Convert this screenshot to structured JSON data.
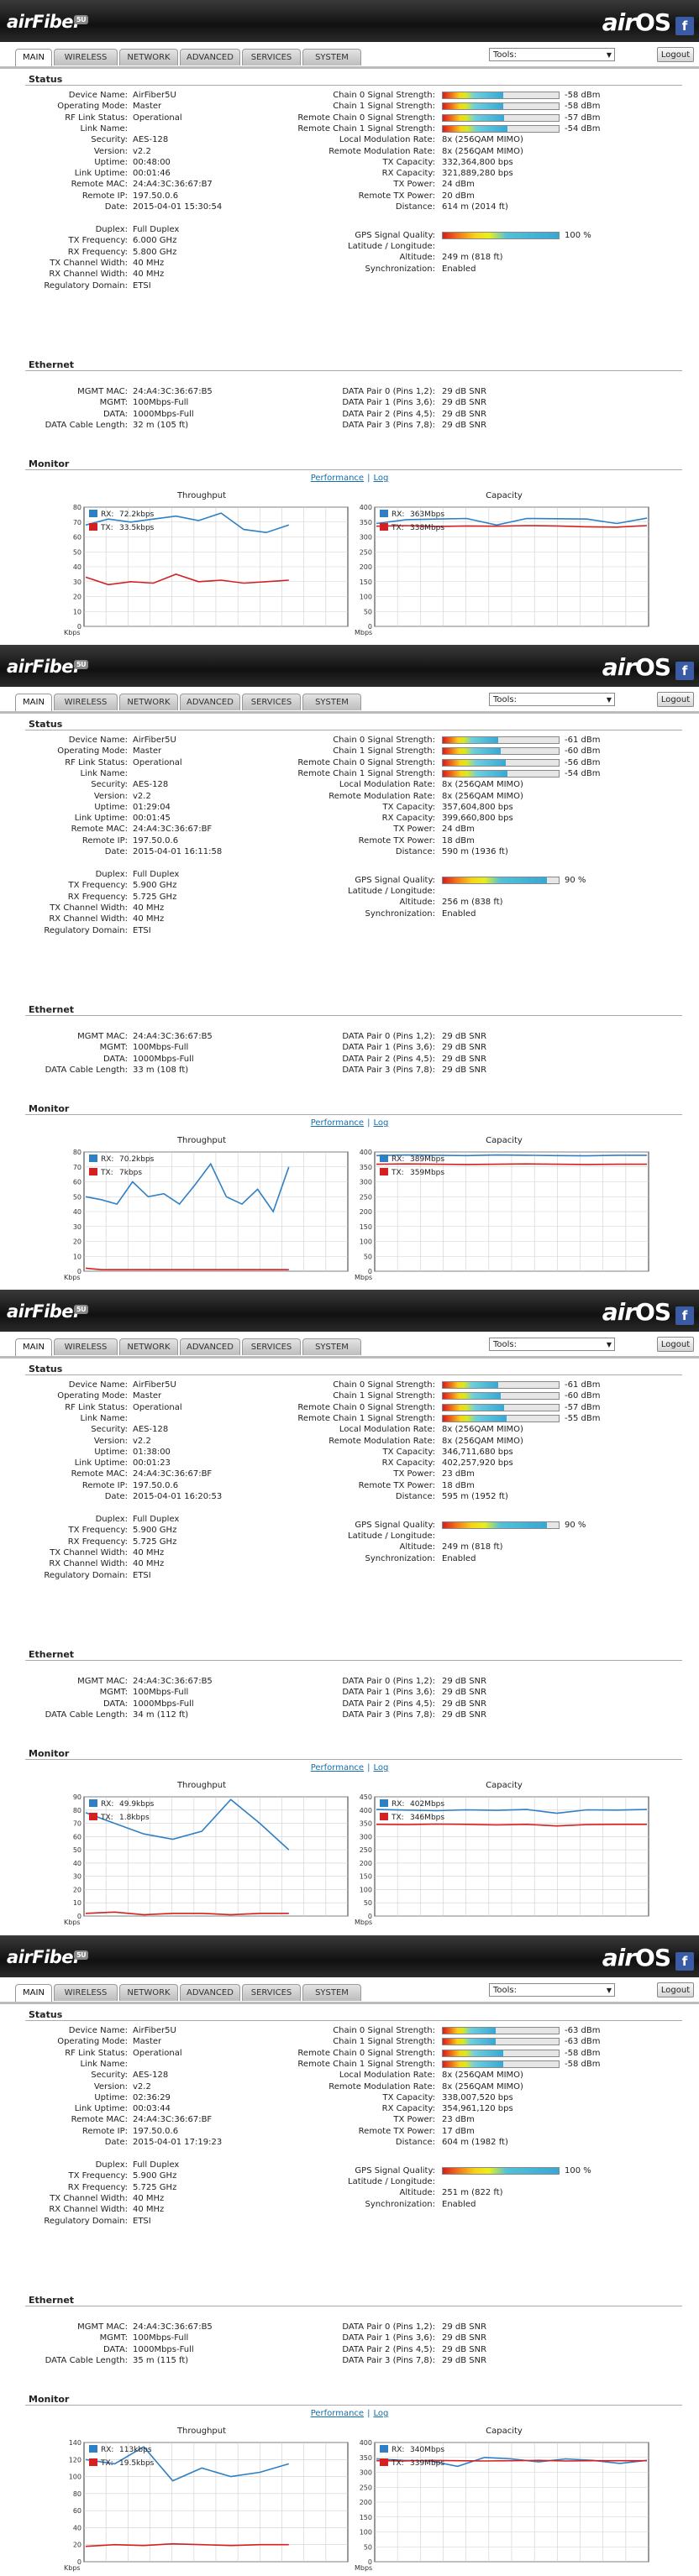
{
  "header": {
    "brand_left": "airFiber",
    "brand_left_badge": "5U",
    "brand_right_prefix": "air",
    "brand_right_suffix": "OS",
    "fb_icon": "f"
  },
  "tabs": [
    "MAIN",
    "WIRELESS",
    "NETWORK",
    "ADVANCED",
    "SERVICES",
    "SYSTEM"
  ],
  "tools_label": "Tools:",
  "logout_label": "Logout",
  "sections": {
    "status": "Status",
    "ethernet": "Ethernet",
    "monitor": "Monitor"
  },
  "labels": {
    "device_name": "Device Name:",
    "operating_mode": "Operating Mode:",
    "rf_link_status": "RF Link Status:",
    "link_name": "Link Name:",
    "security": "Security:",
    "version": "Version:",
    "uptime": "Uptime:",
    "link_uptime": "Link Uptime:",
    "remote_mac": "Remote MAC:",
    "remote_ip": "Remote IP:",
    "date": "Date:",
    "duplex": "Duplex:",
    "tx_frequency": "TX Frequency:",
    "rx_frequency": "RX Frequency:",
    "tx_channel_width": "TX Channel Width:",
    "rx_channel_width": "RX Channel Width:",
    "regulatory_domain": "Regulatory Domain:",
    "chain0": "Chain 0 Signal Strength:",
    "chain1": "Chain 1 Signal Strength:",
    "rchain0": "Remote Chain 0 Signal Strength:",
    "rchain1": "Remote Chain 1 Signal Strength:",
    "local_mod": "Local Modulation Rate:",
    "remote_mod": "Remote Modulation Rate:",
    "tx_capacity": "TX Capacity:",
    "rx_capacity": "RX Capacity:",
    "tx_power": "TX Power:",
    "remote_tx_power": "Remote TX Power:",
    "distance": "Distance:",
    "gps": "GPS Signal Quality:",
    "latlon": "Latitude / Longitude:",
    "altitude": "Altitude:",
    "sync": "Synchronization:",
    "mgmt_mac": "MGMT MAC:",
    "mgmt": "MGMT:",
    "data": "DATA:",
    "cable": "DATA Cable Length:",
    "dp0": "DATA Pair 0 (Pins 1,2):",
    "dp1": "DATA Pair 1 (Pins 3,6):",
    "dp2": "DATA Pair 2 (Pins 4,5):",
    "dp3": "DATA Pair 3 (Pins 7,8):"
  },
  "monitor_links": {
    "performance": "Performance",
    "sep": "|",
    "log": "Log"
  },
  "chart_titles": {
    "throughput": "Throughput",
    "capacity": "Capacity",
    "kbps": "Kbps",
    "mbps": "Mbps",
    "rx_prefix": "RX:",
    "tx_prefix": "TX:"
  },
  "colors": {
    "rx": "#2f7fc4",
    "tx": "#d42020",
    "grid": "#cfcfcf"
  },
  "panels": [
    {
      "status": {
        "device_name": "AirFiber5U",
        "operating_mode": "Master",
        "rf_link_status": "Operational",
        "link_name": "",
        "security": "AES-128",
        "version": "v2.2",
        "uptime": "00:48:00",
        "link_uptime": "00:01:46",
        "remote_mac": "24:A4:3C:36:67:B7",
        "remote_ip": "197.50.0.6",
        "date": "2015-04-01 15:30:54",
        "duplex": "Full Duplex",
        "tx_frequency": "6.000 GHz",
        "rx_frequency": "5.800 GHz",
        "tx_channel_width": "40 MHz",
        "rx_channel_width": "40 MHz",
        "regulatory_domain": "ETSI"
      },
      "signals": {
        "chain0": "-58 dBm",
        "chain1": "-58 dBm",
        "rchain0": "-57 dBm",
        "rchain1": "-54 dBm",
        "chain0_level": 0.52,
        "chain1_level": 0.52,
        "rchain0_level": 0.53,
        "rchain1_level": 0.56
      },
      "link": {
        "local_mod": "8x (256QAM MIMO)",
        "remote_mod": "8x (256QAM MIMO)",
        "tx_capacity": "332,364,800 bps",
        "rx_capacity": "321,889,280 bps",
        "tx_power": "24 dBm",
        "remote_tx_power": "20 dBm",
        "distance": "614 m (2014 ft)",
        "gps": "100 %",
        "gps_level": 1.0,
        "latlon": "",
        "altitude": "249 m (818 ft)",
        "sync": "Enabled"
      },
      "ethernet": {
        "mgmt_mac": "24:A4:3C:36:67:B5",
        "mgmt": "100Mbps-Full",
        "data": "1000Mbps-Full",
        "cable": "32 m (105 ft)",
        "dp0": "29 dB SNR",
        "dp1": "29 dB SNR",
        "dp2": "29 dB SNR",
        "dp3": "29 dB SNR"
      },
      "throughput": {
        "rx_label": "72.2kbps",
        "tx_label": "33.5kbps",
        "y_ticks": [
          "80",
          "70",
          "60",
          "50",
          "40",
          "30",
          "20",
          "10",
          "0"
        ],
        "ymax": 80,
        "rx": [
          68,
          72,
          70,
          72,
          74,
          71,
          76,
          65,
          63,
          68
        ],
        "tx": [
          33,
          28,
          30,
          29,
          35,
          30,
          31,
          29,
          30,
          31
        ]
      },
      "capacity": {
        "rx_label": "363Mbps",
        "tx_label": "338Mbps",
        "y_ticks": [
          "400",
          "350",
          "300",
          "250",
          "200",
          "150",
          "100",
          "50",
          "0"
        ],
        "ymax": 400,
        "rx": [
          345,
          358,
          360,
          362,
          340,
          362,
          361,
          360,
          345,
          363
        ],
        "tx": [
          336,
          338,
          335,
          337,
          336,
          338,
          337,
          334,
          333,
          338
        ]
      }
    },
    {
      "status": {
        "device_name": "AirFiber5U",
        "operating_mode": "Master",
        "rf_link_status": "Operational",
        "link_name": "",
        "security": "AES-128",
        "version": "v2.2",
        "uptime": "01:29:04",
        "link_uptime": "00:01:45",
        "remote_mac": "24:A4:3C:36:67:BF",
        "remote_ip": "197.50.0.6",
        "date": "2015-04-01 16:11:58",
        "duplex": "Full Duplex",
        "tx_frequency": "5.900 GHz",
        "rx_frequency": "5.725 GHz",
        "tx_channel_width": "40 MHz",
        "rx_channel_width": "40 MHz",
        "regulatory_domain": "ETSI"
      },
      "signals": {
        "chain0": "-61 dBm",
        "chain1": "-60 dBm",
        "rchain0": "-56 dBm",
        "rchain1": "-54 dBm",
        "chain0_level": 0.48,
        "chain1_level": 0.5,
        "rchain0_level": 0.54,
        "rchain1_level": 0.56
      },
      "link": {
        "local_mod": "8x (256QAM MIMO)",
        "remote_mod": "8x (256QAM MIMO)",
        "tx_capacity": "357,604,800 bps",
        "rx_capacity": "399,660,800 bps",
        "tx_power": "24 dBm",
        "remote_tx_power": "18 dBm",
        "distance": "590 m (1936 ft)",
        "gps": "90 %",
        "gps_level": 0.9,
        "latlon": "",
        "altitude": "256 m (838 ft)",
        "sync": "Enabled"
      },
      "ethernet": {
        "mgmt_mac": "24:A4:3C:36:67:B5",
        "mgmt": "100Mbps-Full",
        "data": "1000Mbps-Full",
        "cable": "33 m (108 ft)",
        "dp0": "29 dB SNR",
        "dp1": "29 dB SNR",
        "dp2": "29 dB SNR",
        "dp3": "29 dB SNR"
      },
      "throughput": {
        "rx_label": "70.2kbps",
        "tx_label": "7kbps",
        "y_ticks": [
          "80",
          "70",
          "60",
          "50",
          "40",
          "30",
          "20",
          "10",
          "0"
        ],
        "ymax": 80,
        "rx": [
          50,
          48,
          45,
          60,
          50,
          52,
          45,
          58,
          72,
          50,
          45,
          55,
          40,
          70
        ],
        "tx": [
          2,
          1,
          1,
          1,
          1,
          1,
          1,
          1,
          1,
          1,
          1,
          1,
          1,
          1
        ]
      },
      "capacity": {
        "rx_label": "389Mbps",
        "tx_label": "359Mbps",
        "y_ticks": [
          "400",
          "350",
          "300",
          "250",
          "200",
          "150",
          "100",
          "50",
          "0"
        ],
        "ymax": 400,
        "rx": [
          388,
          390,
          389,
          388,
          390,
          389,
          388,
          387,
          389,
          389
        ],
        "tx": [
          359,
          360,
          359,
          358,
          359,
          360,
          359,
          358,
          359,
          359
        ]
      }
    },
    {
      "status": {
        "device_name": "AirFiber5U",
        "operating_mode": "Master",
        "rf_link_status": "Operational",
        "link_name": "",
        "security": "AES-128",
        "version": "v2.2",
        "uptime": "01:38:00",
        "link_uptime": "00:01:23",
        "remote_mac": "24:A4:3C:36:67:BF",
        "remote_ip": "197.50.0.6",
        "date": "2015-04-01 16:20:53",
        "duplex": "Full Duplex",
        "tx_frequency": "5.900 GHz",
        "rx_frequency": "5.725 GHz",
        "tx_channel_width": "40 MHz",
        "rx_channel_width": "40 MHz",
        "regulatory_domain": "ETSI"
      },
      "signals": {
        "chain0": "-61 dBm",
        "chain1": "-60 dBm",
        "rchain0": "-57 dBm",
        "rchain1": "-55 dBm",
        "chain0_level": 0.48,
        "chain1_level": 0.5,
        "rchain0_level": 0.53,
        "rchain1_level": 0.55
      },
      "link": {
        "local_mod": "8x (256QAM MIMO)",
        "remote_mod": "8x (256QAM MIMO)",
        "tx_capacity": "346,711,680 bps",
        "rx_capacity": "402,257,920 bps",
        "tx_power": "23 dBm",
        "remote_tx_power": "18 dBm",
        "distance": "595 m (1952 ft)",
        "gps": "90 %",
        "gps_level": 0.9,
        "latlon": "",
        "altitude": "249 m (818 ft)",
        "sync": "Enabled"
      },
      "ethernet": {
        "mgmt_mac": "24:A4:3C:36:67:B5",
        "mgmt": "100Mbps-Full",
        "data": "1000Mbps-Full",
        "cable": "34 m (112 ft)",
        "dp0": "29 dB SNR",
        "dp1": "29 dB SNR",
        "dp2": "29 dB SNR",
        "dp3": "29 dB SNR"
      },
      "throughput": {
        "rx_label": "49.9kbps",
        "tx_label": "1.8kbps",
        "y_ticks": [
          "90",
          "80",
          "70",
          "60",
          "50",
          "40",
          "30",
          "20",
          "10",
          "0"
        ],
        "ymax": 90,
        "rx": [
          78,
          70,
          62,
          58,
          64,
          88,
          70,
          50
        ],
        "tx": [
          2,
          3,
          1,
          2,
          2,
          1,
          2,
          2
        ]
      },
      "capacity": {
        "rx_label": "402Mbps",
        "tx_label": "346Mbps",
        "y_ticks": [
          "450",
          "400",
          "350",
          "300",
          "250",
          "200",
          "150",
          "100",
          "50",
          "0"
        ],
        "ymax": 450,
        "rx": [
          402,
          400,
          398,
          401,
          399,
          402,
          388,
          401,
          400,
          402
        ],
        "tx": [
          346,
          345,
          347,
          346,
          344,
          346,
          340,
          345,
          346,
          346
        ]
      }
    },
    {
      "status": {
        "device_name": "AirFiber5U",
        "operating_mode": "Master",
        "rf_link_status": "Operational",
        "link_name": "",
        "security": "AES-128",
        "version": "v2.2",
        "uptime": "02:36:29",
        "link_uptime": "00:03:44",
        "remote_mac": "24:A4:3C:36:67:BF",
        "remote_ip": "197.50.0.6",
        "date": "2015-04-01 17:19:23",
        "duplex": "Full Duplex",
        "tx_frequency": "5.900 GHz",
        "rx_frequency": "5.725 GHz",
        "tx_channel_width": "40 MHz",
        "rx_channel_width": "40 MHz",
        "regulatory_domain": "ETSI"
      },
      "signals": {
        "chain0": "-63 dBm",
        "chain1": "-63 dBm",
        "rchain0": "-58 dBm",
        "rchain1": "-58 dBm",
        "chain0_level": 0.46,
        "chain1_level": 0.46,
        "rchain0_level": 0.52,
        "rchain1_level": 0.52
      },
      "link": {
        "local_mod": "8x (256QAM MIMO)",
        "remote_mod": "8x (256QAM MIMO)",
        "tx_capacity": "338,007,520 bps",
        "rx_capacity": "354,961,120 bps",
        "tx_power": "23 dBm",
        "remote_tx_power": "17 dBm",
        "distance": "604 m (1982 ft)",
        "gps": "100 %",
        "gps_level": 1.0,
        "latlon": "",
        "altitude": "251 m (822 ft)",
        "sync": "Enabled"
      },
      "ethernet": {
        "mgmt_mac": "24:A4:3C:36:67:B5",
        "mgmt": "100Mbps-Full",
        "data": "1000Mbps-Full",
        "cable": "35 m (115 ft)",
        "dp0": "29 dB SNR",
        "dp1": "29 dB SNR",
        "dp2": "29 dB SNR",
        "dp3": "29 dB SNR"
      },
      "throughput": {
        "rx_label": "113kbps",
        "tx_label": "19.5kbps",
        "y_ticks": [
          "140",
          "120",
          "100",
          "80",
          "60",
          "40",
          "20",
          "0"
        ],
        "ymax": 140,
        "rx": [
          120,
          115,
          135,
          95,
          110,
          100,
          105,
          115
        ],
        "tx": [
          18,
          20,
          19,
          21,
          20,
          19,
          20,
          20
        ]
      },
      "capacity": {
        "rx_label": "340Mbps",
        "tx_label": "339Mbps",
        "y_ticks": [
          "400",
          "350",
          "300",
          "250",
          "200",
          "150",
          "100",
          "50",
          "0"
        ],
        "ymax": 400,
        "rx": [
          345,
          340,
          338,
          320,
          350,
          345,
          335,
          345,
          340,
          330,
          340
        ],
        "tx": [
          339,
          338,
          340,
          339,
          338,
          339,
          340,
          338,
          339,
          339,
          339
        ]
      }
    }
  ]
}
